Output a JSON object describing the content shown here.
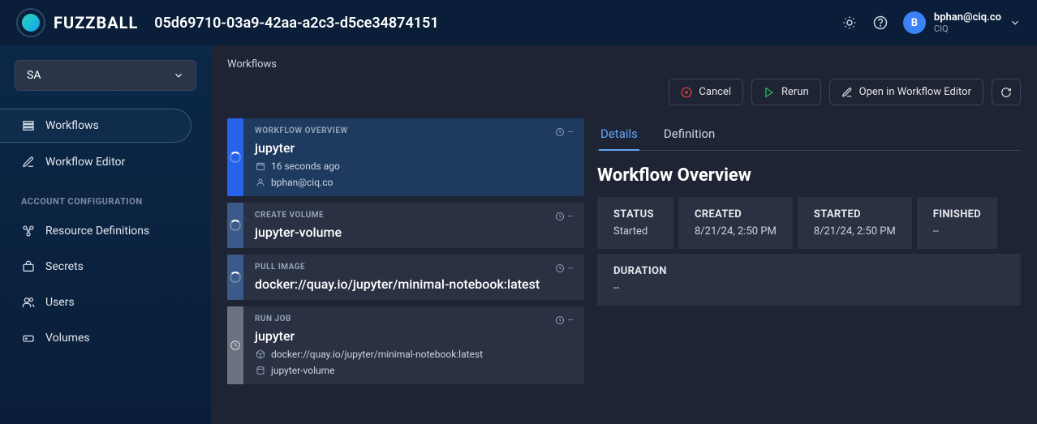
{
  "brand": "FUZZBALL",
  "page_title": "05d69710-03a9-42aa-a2c3-d5ce34874151",
  "user": {
    "initial": "B",
    "email": "bphan@ciq.co",
    "org": "CIQ"
  },
  "sidebar": {
    "org_selected": "SA",
    "nav": {
      "workflows": "Workflows",
      "editor": "Workflow Editor"
    },
    "section_label": "ACCOUNT CONFIGURATION",
    "config": {
      "resource_defs": "Resource Definitions",
      "secrets": "Secrets",
      "users": "Users",
      "volumes": "Volumes"
    }
  },
  "breadcrumb": "Workflows",
  "actions": {
    "cancel": "Cancel",
    "rerun": "Rerun",
    "open_editor": "Open in Workflow Editor"
  },
  "steps": [
    {
      "kind": "WORKFLOW OVERVIEW",
      "title": "jupyter",
      "time": "--",
      "status": "running",
      "meta": [
        {
          "icon": "calendar",
          "text": "16 seconds ago"
        },
        {
          "icon": "user",
          "text": "bphan@ciq.co"
        }
      ]
    },
    {
      "kind": "CREATE VOLUME",
      "title": "jupyter-volume",
      "time": "--",
      "status": "running",
      "meta": []
    },
    {
      "kind": "PULL IMAGE",
      "title": "docker://quay.io/jupyter/minimal-notebook:latest",
      "time": "--",
      "status": "running",
      "meta": []
    },
    {
      "kind": "RUN JOB",
      "title": "jupyter",
      "time": "--",
      "status": "pending",
      "meta": [
        {
          "icon": "cube",
          "text": "docker://quay.io/jupyter/minimal-notebook:latest"
        },
        {
          "icon": "disk",
          "text": "jupyter-volume"
        }
      ]
    }
  ],
  "details": {
    "tabs": {
      "details": "Details",
      "definition": "Definition"
    },
    "heading": "Workflow Overview",
    "info": {
      "status_label": "STATUS",
      "status_value": "Started",
      "created_label": "CREATED",
      "created_value": "8/21/24, 2:50 PM",
      "started_label": "STARTED",
      "started_value": "8/21/24, 2:50 PM",
      "finished_label": "FINISHED",
      "finished_value": "--",
      "duration_label": "DURATION",
      "duration_value": "--"
    }
  }
}
